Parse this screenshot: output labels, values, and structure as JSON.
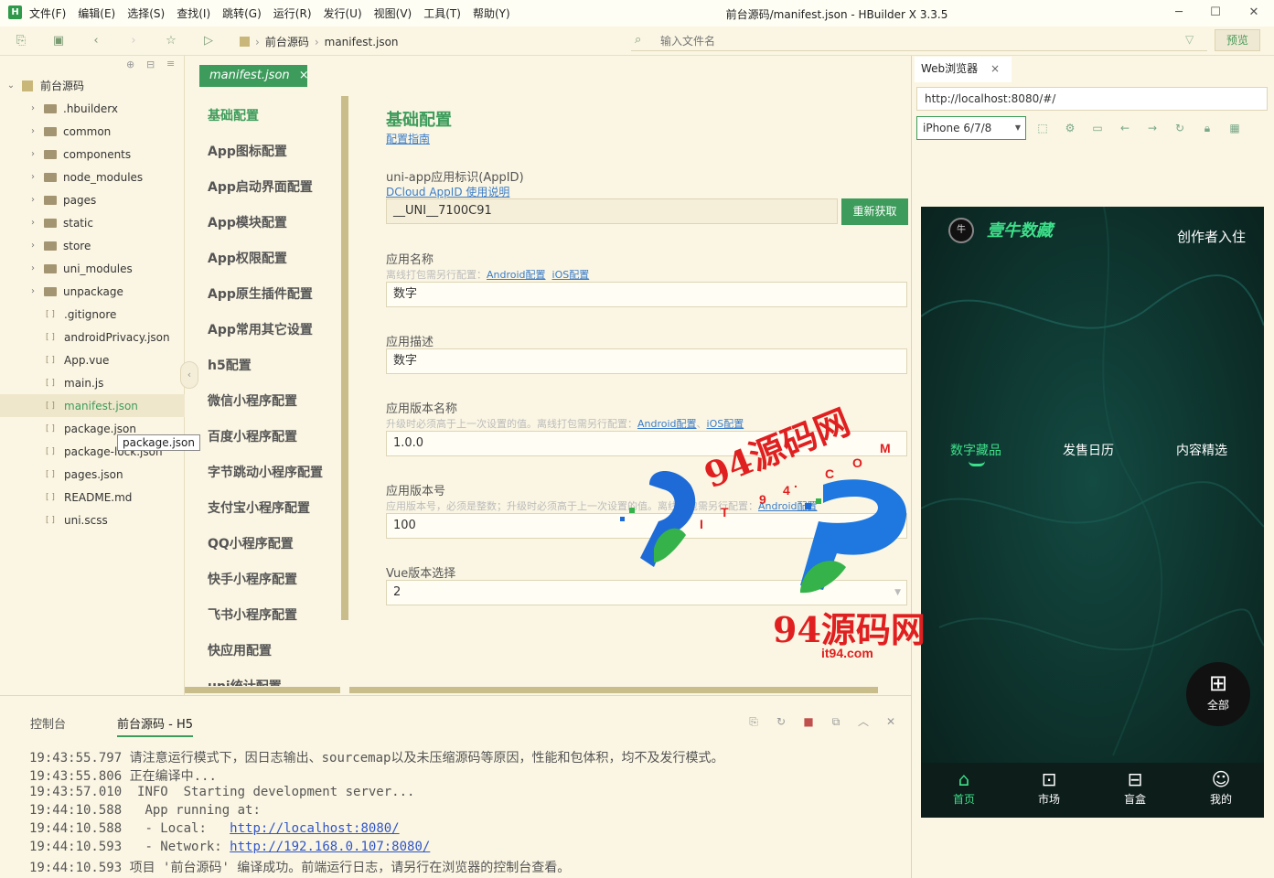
{
  "app": {
    "logo_letter": "H",
    "title": "前台源码/manifest.json - HBuilder X 3.3.5",
    "menu": [
      "文件(F)",
      "编辑(E)",
      "选择(S)",
      "查找(I)",
      "跳转(G)",
      "运行(R)",
      "发行(U)",
      "视图(V)",
      "工具(T)",
      "帮助(Y)"
    ]
  },
  "toolbar": {
    "breadcrumb": [
      "前台源码",
      "manifest.json"
    ],
    "search_placeholder": "输入文件名",
    "preview_label": "预览"
  },
  "sidebar": {
    "project": "前台源码",
    "items": [
      {
        "label": ".hbuilderx",
        "type": "folder"
      },
      {
        "label": "common",
        "type": "folder"
      },
      {
        "label": "components",
        "type": "folder"
      },
      {
        "label": "node_modules",
        "type": "folder"
      },
      {
        "label": "pages",
        "type": "folder"
      },
      {
        "label": "static",
        "type": "folder"
      },
      {
        "label": "store",
        "type": "folder"
      },
      {
        "label": "uni_modules",
        "type": "folder"
      },
      {
        "label": "unpackage",
        "type": "folder"
      },
      {
        "label": ".gitignore",
        "type": "file"
      },
      {
        "label": "androidPrivacy.json",
        "type": "file"
      },
      {
        "label": "App.vue",
        "type": "file"
      },
      {
        "label": "main.js",
        "type": "file"
      },
      {
        "label": "manifest.json",
        "type": "file",
        "active": true
      },
      {
        "label": "package.json",
        "type": "file"
      },
      {
        "label": "package-lock.json",
        "type": "file"
      },
      {
        "label": "pages.json",
        "type": "file"
      },
      {
        "label": "README.md",
        "type": "file"
      },
      {
        "label": "uni.scss",
        "type": "file"
      }
    ],
    "tooltip": "package.json"
  },
  "editor": {
    "tab": "manifest.json",
    "nav": [
      "基础配置",
      "App图标配置",
      "App启动界面配置",
      "App模块配置",
      "App权限配置",
      "App原生插件配置",
      "App常用其它设置",
      "h5配置",
      "微信小程序配置",
      "百度小程序配置",
      "字节跳动小程序配置",
      "支付宝小程序配置",
      "QQ小程序配置",
      "快手小程序配置",
      "飞书小程序配置",
      "快应用配置",
      "uni统计配置"
    ],
    "form": {
      "title": "基础配置",
      "guide_link": "配置指南",
      "appid_label": "uni-app应用标识(AppID)",
      "appid_link": "DCloud AppID 使用说明",
      "appid_value": "__UNI__7100C91",
      "regen_label": "重新获取",
      "name_label": "应用名称",
      "name_hint": "离线打包需另行配置：",
      "android_link": "Android配置",
      "ios_link": "iOS配置",
      "name_value": "数字",
      "desc_label": "应用描述",
      "desc_value": "数字",
      "version_name_label": "应用版本名称",
      "version_name_hint": "升级时必须高于上一次设置的值。离线打包需另行配置：",
      "version_name_value": "1.0.0",
      "version_code_label": "应用版本号",
      "version_code_hint": "应用版本号，必须是整数；升级时必须高于上一次设置的值。离线打包需另行配置：",
      "version_code_link": "Android配置",
      "version_code_value": "100",
      "vue_label": "Vue版本选择",
      "vue_value": "2"
    }
  },
  "console": {
    "tab1": "控制台",
    "tab2": "前台源码 - H5",
    "lines": [
      {
        "time": "19:43:55.797",
        "text": " 请注意运行模式下，因日志输出、sourcemap以及未压缩源码等原因，性能和包体积，均不及发行模式。"
      },
      {
        "time": "19:43:55.806",
        "text": " 正在编译中..."
      },
      {
        "time": "19:43:57.010",
        "text": "  INFO  Starting development server..."
      },
      {
        "time": "19:44:10.588",
        "text": "   App running at:"
      },
      {
        "time": "19:44:10.588",
        "text": "   - Local:   ",
        "link": "http://localhost:8080/"
      },
      {
        "time": "19:44:10.593",
        "text": "   - Network: ",
        "link": "http://192.168.0.107:8080/"
      },
      {
        "time": "19:44:10.593",
        "text": " 项目 '前台源码' 编译成功。前端运行日志，请另行在浏览器的控制台查看。"
      }
    ]
  },
  "browser": {
    "tab": "Web浏览器",
    "url": "http://localhost:8080/#/",
    "device": "iPhone 6/7/8"
  },
  "phone": {
    "brand": "壹牛数藏",
    "creator": "创作者入住",
    "tabs": [
      "数字藏品",
      "发售日历",
      "内容精选"
    ],
    "all_label": "全部",
    "nav": [
      "首页",
      "市场",
      "盲盒",
      "我的"
    ],
    "accent": "#3de08a"
  },
  "watermark": {
    "text1": "94源码网",
    "letters": [
      "I",
      "T",
      "9",
      "4",
      ".",
      "C",
      "O",
      "M"
    ],
    "text2": "94源码网",
    "url": "it94.com"
  }
}
